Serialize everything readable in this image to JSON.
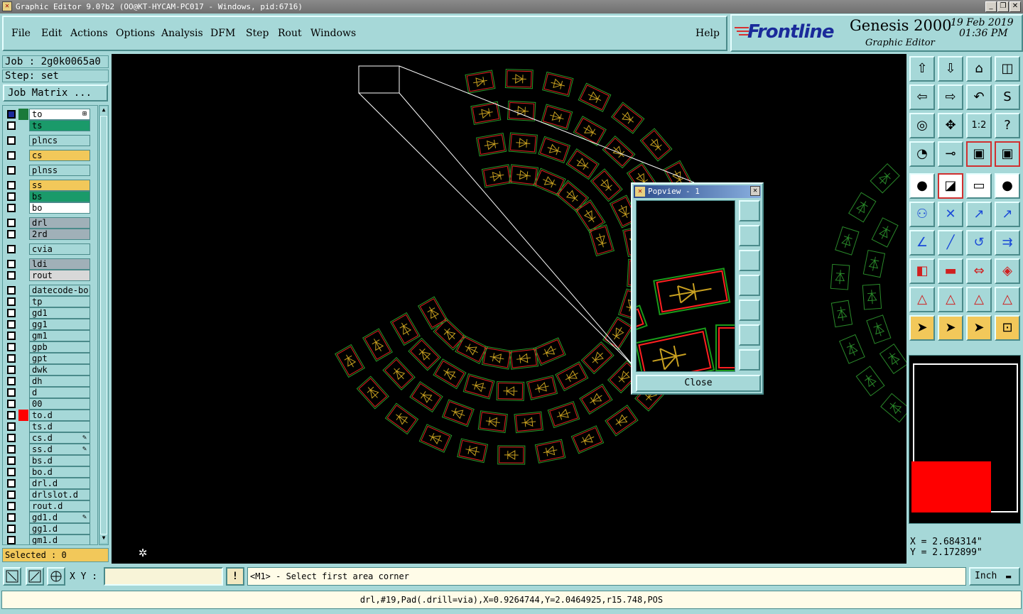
{
  "window": {
    "title": "Graphic Editor 9.0?b2 (OO@KT-HYCAM-PC017 - Windows, pid:6716)"
  },
  "menu": [
    "File",
    "Edit",
    "Actions",
    "Options",
    "Analysis",
    "DFM",
    "Step",
    "Rout",
    "Windows"
  ],
  "help": "Help",
  "brand": {
    "logo": "Frontline",
    "product": "Genesis 2000",
    "subtitle": "Graphic Editor",
    "date": "19 Feb 2019",
    "time": "01:36 PM"
  },
  "job": {
    "job": "Job : 2g0k0065a0",
    "step": "Step: set",
    "matrix_button": "Job Matrix ..."
  },
  "layers": [
    {
      "name": "to",
      "color": "#ffffff",
      "swatch": "#1a7a3a",
      "mark": "⊞"
    },
    {
      "name": "ts",
      "color": "#1a9a6a",
      "swatch": "",
      "mark": ""
    },
    {
      "name": "plncs",
      "color": "#a6d8d8",
      "swatch": "",
      "mark": ""
    },
    {
      "name": "cs",
      "color": "#f2c85a",
      "swatch": "",
      "mark": ""
    },
    {
      "name": "plnss",
      "color": "#a6d8d8",
      "swatch": "",
      "mark": ""
    },
    {
      "name": "ss",
      "color": "#f2c85a",
      "swatch": "",
      "mark": ""
    },
    {
      "name": "bs",
      "color": "#1a9a6a",
      "swatch": "",
      "mark": ""
    },
    {
      "name": "bo",
      "color": "#ffffff",
      "swatch": "",
      "mark": ""
    },
    {
      "name": "drl",
      "color": "#a0b0b8",
      "swatch": "",
      "mark": ""
    },
    {
      "name": "2rd",
      "color": "#a0b0b8",
      "swatch": "",
      "mark": ""
    },
    {
      "name": "cvia",
      "color": "#a6d8d8",
      "swatch": "",
      "mark": ""
    },
    {
      "name": "ldi",
      "color": "#a0b0b8",
      "swatch": "",
      "mark": ""
    },
    {
      "name": "rout",
      "color": "#d8d8d8",
      "swatch": "",
      "mark": ""
    },
    {
      "name": "datecode-bo",
      "color": "#a6d8d8",
      "swatch": "",
      "mark": ""
    },
    {
      "name": "tp",
      "color": "#a6d8d8",
      "swatch": "",
      "mark": ""
    },
    {
      "name": "gd1",
      "color": "#a6d8d8",
      "swatch": "",
      "mark": ""
    },
    {
      "name": "gg1",
      "color": "#a6d8d8",
      "swatch": "",
      "mark": ""
    },
    {
      "name": "gm1",
      "color": "#a6d8d8",
      "swatch": "",
      "mark": ""
    },
    {
      "name": "gpb",
      "color": "#a6d8d8",
      "swatch": "",
      "mark": ""
    },
    {
      "name": "gpt",
      "color": "#a6d8d8",
      "swatch": "",
      "mark": ""
    },
    {
      "name": "dwk",
      "color": "#a6d8d8",
      "swatch": "",
      "mark": ""
    },
    {
      "name": "dh",
      "color": "#a6d8d8",
      "swatch": "",
      "mark": ""
    },
    {
      "name": "d",
      "color": "#a6d8d8",
      "swatch": "",
      "mark": ""
    },
    {
      "name": "00",
      "color": "#a6d8d8",
      "swatch": "",
      "mark": ""
    },
    {
      "name": "to.d",
      "color": "#a6d8d8",
      "swatch": "#ff0000",
      "mark": ""
    },
    {
      "name": "ts.d",
      "color": "#a6d8d8",
      "swatch": "",
      "mark": ""
    },
    {
      "name": "cs.d",
      "color": "#a6d8d8",
      "swatch": "",
      "mark": "✎"
    },
    {
      "name": "ss.d",
      "color": "#a6d8d8",
      "swatch": "",
      "mark": "✎"
    },
    {
      "name": "bs.d",
      "color": "#a6d8d8",
      "swatch": "",
      "mark": ""
    },
    {
      "name": "bo.d",
      "color": "#a6d8d8",
      "swatch": "",
      "mark": ""
    },
    {
      "name": "drl.d",
      "color": "#a6d8d8",
      "swatch": "",
      "mark": ""
    },
    {
      "name": "drlslot.d",
      "color": "#a6d8d8",
      "swatch": "",
      "mark": ""
    },
    {
      "name": "rout.d",
      "color": "#a6d8d8",
      "swatch": "",
      "mark": ""
    },
    {
      "name": "gd1.d",
      "color": "#a6d8d8",
      "swatch": "",
      "mark": "✎"
    },
    {
      "name": "gg1.d",
      "color": "#a6d8d8",
      "swatch": "",
      "mark": ""
    },
    {
      "name": "gm1.d",
      "color": "#a6d8d8",
      "swatch": "",
      "mark": ""
    }
  ],
  "selected": "Selected : 0",
  "popview": {
    "title": "Popview - 1",
    "close": "Close"
  },
  "coords": {
    "x": "X = 2.684314\"",
    "y": "Y = 2.172899\""
  },
  "xy_label": "X Y :",
  "xy_value": "",
  "prompt": "<M1> - Select first area corner",
  "unit": "Inch",
  "status": "drl,#19,Pad(.drill=via),X=0.9264744,Y=2.0464925,r15.748,POS",
  "tool_icons": [
    "open-icon",
    "save-icon",
    "home-icon",
    "split-icon",
    "zoom-left-icon",
    "zoom-right-icon",
    "redo-icon",
    "snake-icon",
    "fit-icon",
    "zoom-fit-icon",
    "scale-icon",
    "question-icon",
    "palette-icon",
    "drill-icon",
    "layer-map-icon",
    "layer-map2-icon",
    "pad-icon",
    "measure-icon",
    "ruler-icon",
    "circle-icon",
    "route-icon",
    "cross-icon",
    "move-icon",
    "connect-icon",
    "angle-icon",
    "line-icon",
    "arc-icon",
    "ff-icon",
    "mirror-icon",
    "bar-icon",
    "resize-icon",
    "shapes-icon",
    "triangle-icon",
    "triangle2-icon",
    "triangle3-icon",
    "triangle4-icon",
    "pointer-icon",
    "pointer2-icon",
    "pointer3-icon",
    "node-icon"
  ]
}
